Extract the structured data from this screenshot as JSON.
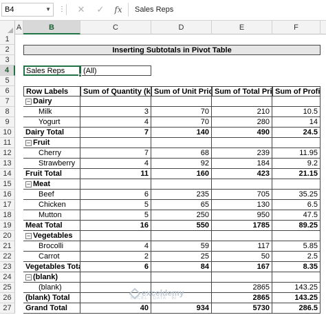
{
  "name_box": "B4",
  "formula_icons": {
    "cancel": "✕",
    "enter": "✓",
    "fx": "fx"
  },
  "formula_value": "Sales Reps",
  "columns": [
    "A",
    "B",
    "C",
    "D",
    "E",
    "F"
  ],
  "selected_column": "B",
  "row_numbers": [
    "1",
    "2",
    "3",
    "4",
    "5",
    "6",
    "7",
    "8",
    "9",
    "10",
    "11",
    "12",
    "13",
    "14",
    "15",
    "16",
    "17",
    "18",
    "19",
    "20",
    "21",
    "22",
    "23",
    "24",
    "25",
    "26",
    "27"
  ],
  "selected_row": "4",
  "title": "Inserting Subtotals in Pivot Table",
  "filter": {
    "label": "Sales Reps",
    "value": "(All)"
  },
  "headers": [
    "Row Labels",
    "Sum of Quantity (kg)",
    "Sum of Unit Price",
    "Sum of Total Price",
    "Sum of Profit"
  ],
  "rows": [
    {
      "type": "group",
      "label": "Dairy",
      "qty": "",
      "unit": "",
      "total": "",
      "profit": ""
    },
    {
      "type": "item",
      "label": "Milk",
      "qty": "3",
      "unit": "70",
      "total": "210",
      "profit": "10.5"
    },
    {
      "type": "item",
      "label": "Yogurt",
      "qty": "4",
      "unit": "70",
      "total": "280",
      "profit": "14"
    },
    {
      "type": "subtotal",
      "label": "Dairy Total",
      "qty": "7",
      "unit": "140",
      "total": "490",
      "profit": "24.5"
    },
    {
      "type": "group",
      "label": "Fruit",
      "qty": "",
      "unit": "",
      "total": "",
      "profit": ""
    },
    {
      "type": "item",
      "label": "Cherry",
      "qty": "7",
      "unit": "68",
      "total": "239",
      "profit": "11.95"
    },
    {
      "type": "item",
      "label": "Strawberry",
      "qty": "4",
      "unit": "92",
      "total": "184",
      "profit": "9.2"
    },
    {
      "type": "subtotal",
      "label": "Fruit Total",
      "qty": "11",
      "unit": "160",
      "total": "423",
      "profit": "21.15"
    },
    {
      "type": "group",
      "label": "Meat",
      "qty": "",
      "unit": "",
      "total": "",
      "profit": ""
    },
    {
      "type": "item",
      "label": "Beef",
      "qty": "6",
      "unit": "235",
      "total": "705",
      "profit": "35.25"
    },
    {
      "type": "item",
      "label": "Chicken",
      "qty": "5",
      "unit": "65",
      "total": "130",
      "profit": "6.5"
    },
    {
      "type": "item",
      "label": "Mutton",
      "qty": "5",
      "unit": "250",
      "total": "950",
      "profit": "47.5"
    },
    {
      "type": "subtotal",
      "label": "Meat Total",
      "qty": "16",
      "unit": "550",
      "total": "1785",
      "profit": "89.25"
    },
    {
      "type": "group",
      "label": "Vegetables",
      "qty": "",
      "unit": "",
      "total": "",
      "profit": ""
    },
    {
      "type": "item",
      "label": "Brocolli",
      "qty": "4",
      "unit": "59",
      "total": "117",
      "profit": "5.85"
    },
    {
      "type": "item",
      "label": "Carrot",
      "qty": "2",
      "unit": "25",
      "total": "50",
      "profit": "2.5"
    },
    {
      "type": "subtotal",
      "label": "Vegetables Total",
      "qty": "6",
      "unit": "84",
      "total": "167",
      "profit": "8.35"
    },
    {
      "type": "group",
      "label": "(blank)",
      "qty": "",
      "unit": "",
      "total": "",
      "profit": ""
    },
    {
      "type": "item",
      "label": "(blank)",
      "qty": "",
      "unit": "",
      "total": "2865",
      "profit": "143.25"
    },
    {
      "type": "subtotal",
      "label": "(blank) Total",
      "qty": "",
      "unit": "",
      "total": "2865",
      "profit": "143.25"
    },
    {
      "type": "grand",
      "label": "Grand Total",
      "qty": "40",
      "unit": "934",
      "total": "5730",
      "profit": "286.5"
    }
  ],
  "watermark": {
    "brand": "exceldemy",
    "tagline": "EXCEL · DATA · BI"
  },
  "colors": {
    "excel_green": "#217346",
    "header_gray": "#f3f3f3",
    "title_fill": "#e6e6e6"
  },
  "icons": {
    "filter_dropdown": "chevron-down-icon",
    "collapse": "minus-box-icon"
  }
}
